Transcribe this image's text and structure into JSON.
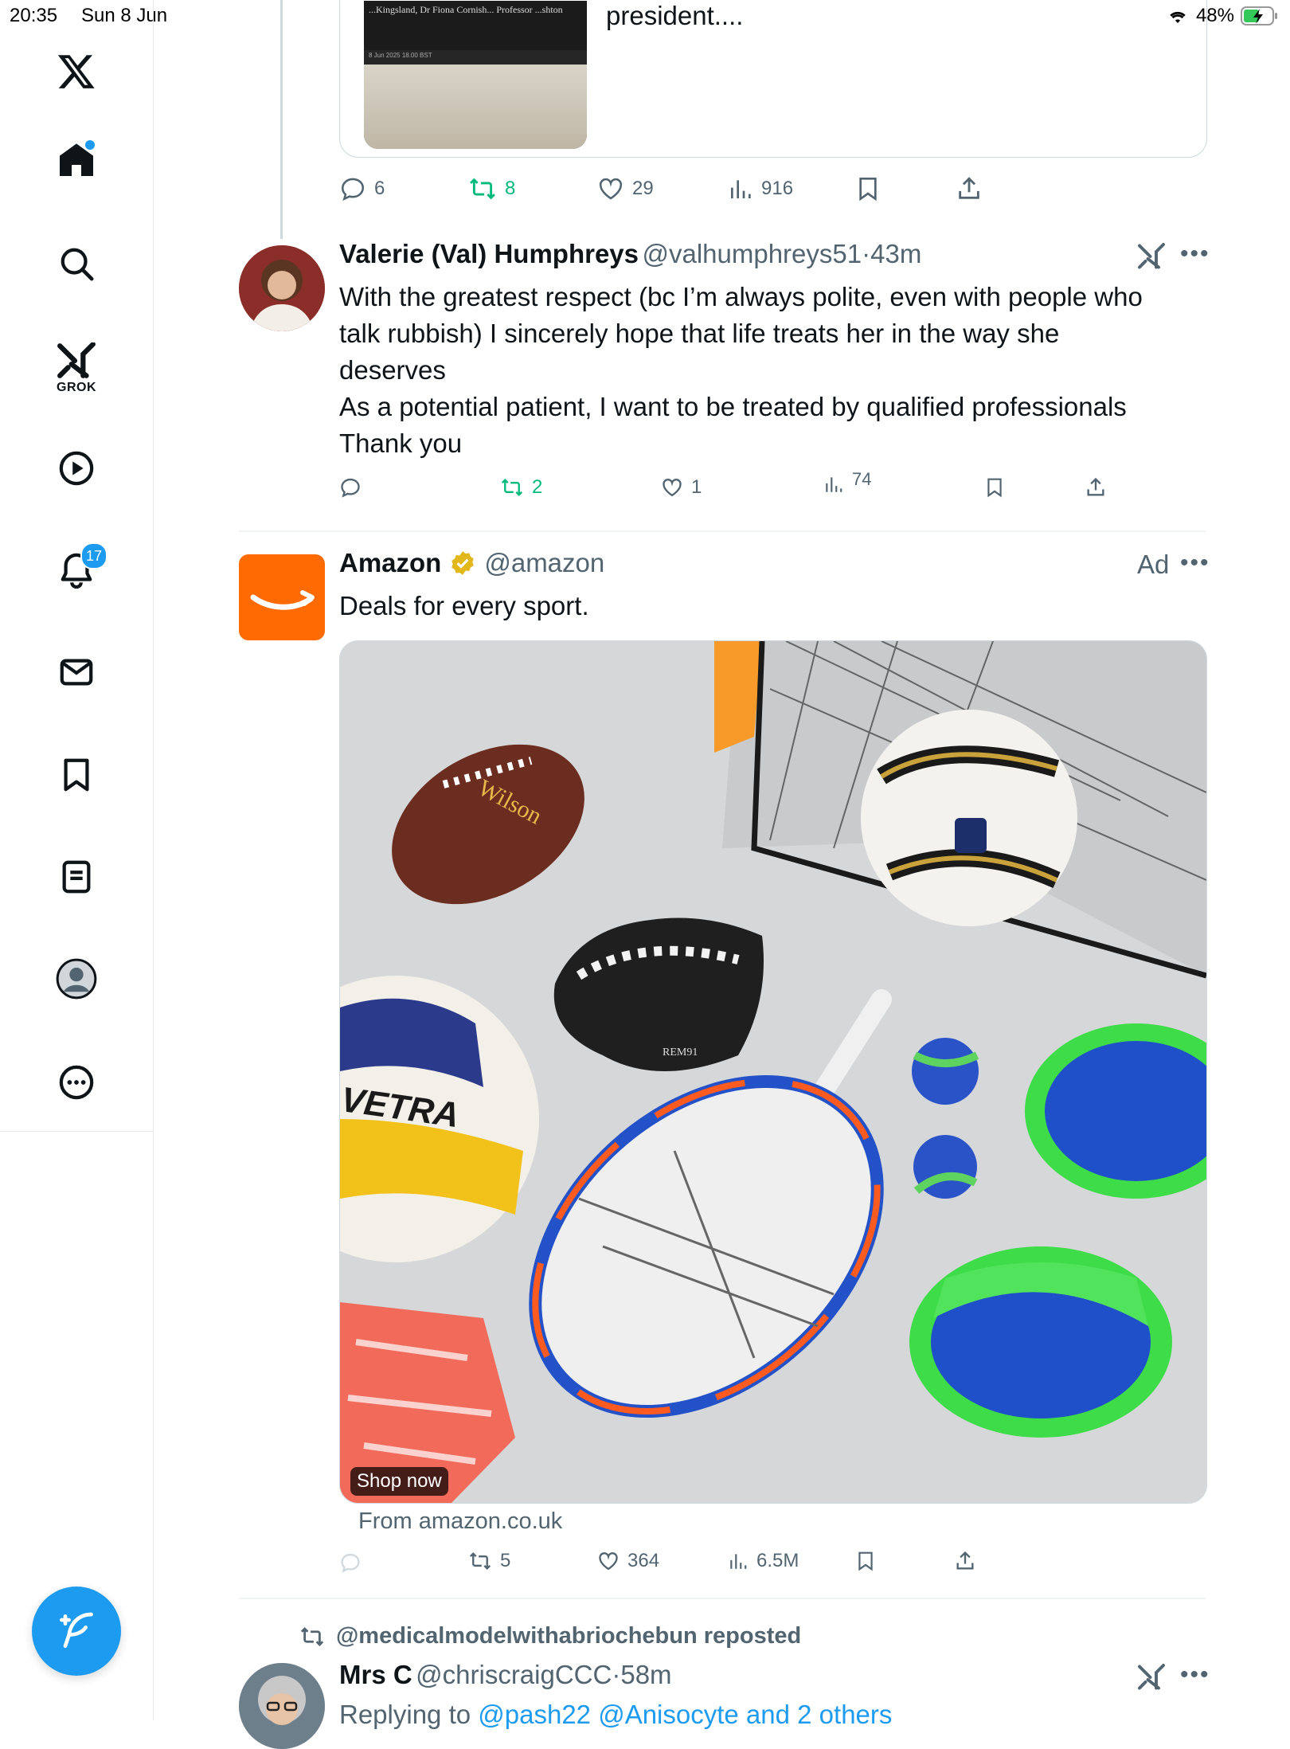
{
  "status_bar": {
    "time": "20:35",
    "date": "Sun 8 Jun",
    "battery": "48%"
  },
  "sidebar": {
    "notifications_badge": "17",
    "grok_label": "GROK"
  },
  "quoted_tweet": {
    "snippet": "president....",
    "thumb_header": "...Kingsland, Dr Fiona Cornish... Professor ...shton",
    "thumb_date": "8 Jun 2025 18.00 BST"
  },
  "tweet1_actions": {
    "replies": "6",
    "reposts": "8",
    "likes": "29",
    "views": "916"
  },
  "tweet2": {
    "name": "Valerie (Val) Humphreys",
    "handle": "@valhumphreys51",
    "sep": "·",
    "time": "43m",
    "lines": [
      "With the greatest respect (bc I’m always polite, even with people who",
      "talk rubbish) I sincerely hope that life treats her in the way she",
      "deserves",
      "As a potential patient, I want to be treated by qualified professionals",
      "Thank you"
    ],
    "reposts": "2",
    "likes": "1",
    "views": "74"
  },
  "ad_tweet": {
    "name": "Amazon",
    "handle": "@amazon",
    "ad_label": "Ad",
    "text": "Deals for every sport.",
    "shop_now": "Shop now",
    "from": "From amazon.co.uk",
    "reposts": "5",
    "likes": "364",
    "views": "6.5M",
    "media_text": {
      "ball_brand": "Wilson",
      "volleyball_brand": "VETRA",
      "glove_text": "REM91"
    }
  },
  "tweet4": {
    "reposted_by": "@medicalmodelwithabriochebun reposted",
    "name": "Mrs C",
    "handle": "@chriscraigCCC",
    "sep": "·",
    "time": "58m",
    "replying_prefix": "Replying to ",
    "replying_to": "@pash22 @Anisocyte and 2 others"
  },
  "colors": {
    "accent": "#1d9bf0",
    "repost_green": "#00ba7c",
    "amazon_orange": "#ff6b00",
    "verified_gold": "#e2b719"
  }
}
